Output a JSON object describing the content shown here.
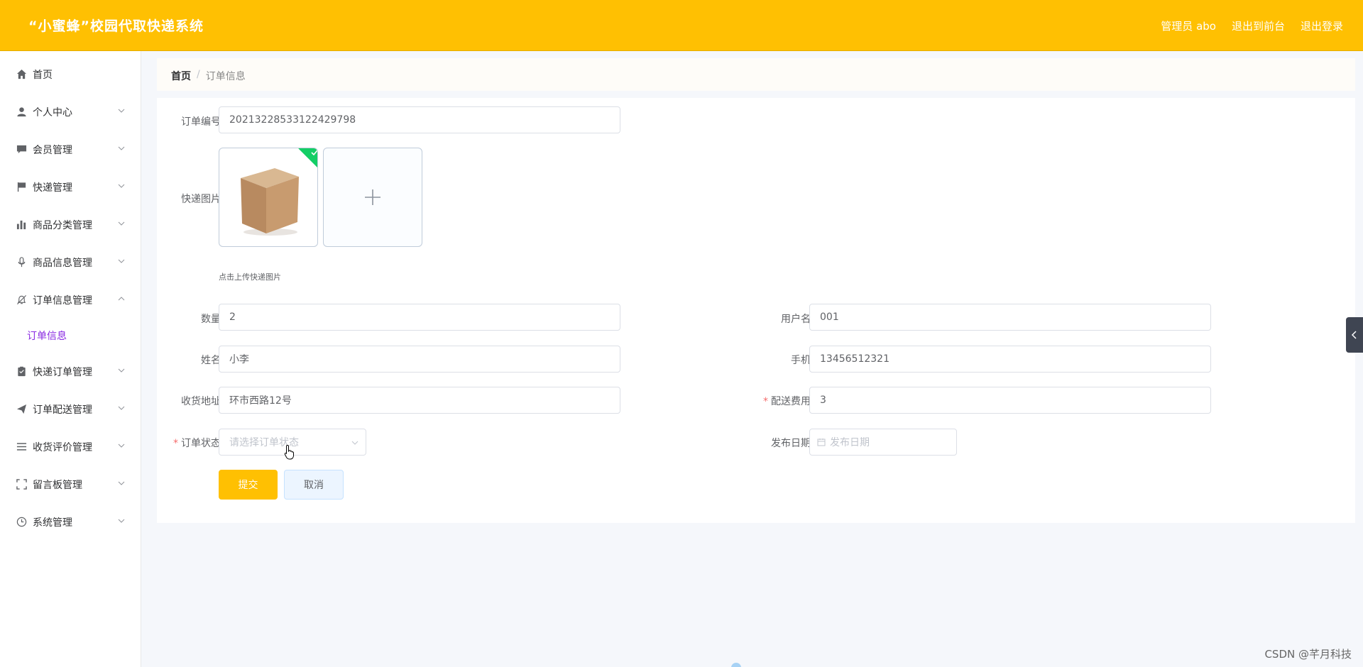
{
  "header": {
    "title": "“小蜜蜂”校园代取快递系统",
    "admin": "管理员 abo",
    "frontend": "退出到前台",
    "logout": "退出登录"
  },
  "sidebar": {
    "items": [
      {
        "label": "首页",
        "icon": "home-icon"
      },
      {
        "label": "个人中心",
        "icon": "user-icon"
      },
      {
        "label": "会员管理",
        "icon": "chat-icon"
      },
      {
        "label": "快递管理",
        "icon": "flag-icon"
      },
      {
        "label": "商品分类管理",
        "icon": "bar-chart-icon"
      },
      {
        "label": "商品信息管理",
        "icon": "microphone-icon"
      },
      {
        "label": "订单信息管理",
        "icon": "bell-off-icon"
      },
      {
        "label": "快递订单管理",
        "icon": "clipboard-icon"
      },
      {
        "label": "订单配送管理",
        "icon": "send-icon"
      },
      {
        "label": "收货评价管理",
        "icon": "list-icon"
      },
      {
        "label": "留言板管理",
        "icon": "fullscreen-icon"
      },
      {
        "label": "系统管理",
        "icon": "clock-icon"
      }
    ],
    "subitem": "订单信息"
  },
  "breadcrumb": {
    "home": "首页",
    "separator": "/",
    "current": "订单信息"
  },
  "form": {
    "order_no_label": "订单编号",
    "order_no": "20213228533122429798",
    "image_label": "快递图片",
    "upload_tip": "点击上传快递图片",
    "quantity_label": "数量",
    "quantity": "2",
    "username_label": "用户名",
    "username": "001",
    "name_label": "姓名",
    "name": "小李",
    "phone_label": "手机",
    "phone": "13456512321",
    "address_label": "收货地址",
    "address": "环市西路12号",
    "fee_label": "配送费用",
    "fee": "3",
    "status_label": "订单状态",
    "status_placeholder": "请选择订单状态",
    "date_label": "发布日期",
    "date_placeholder": "发布日期",
    "submit": "提交",
    "cancel": "取消"
  },
  "watermark": "CSDN @芊月科技",
  "colors": {
    "accent": "#ffc002",
    "submenu": "#8a2be2",
    "success": "#13ce66"
  }
}
